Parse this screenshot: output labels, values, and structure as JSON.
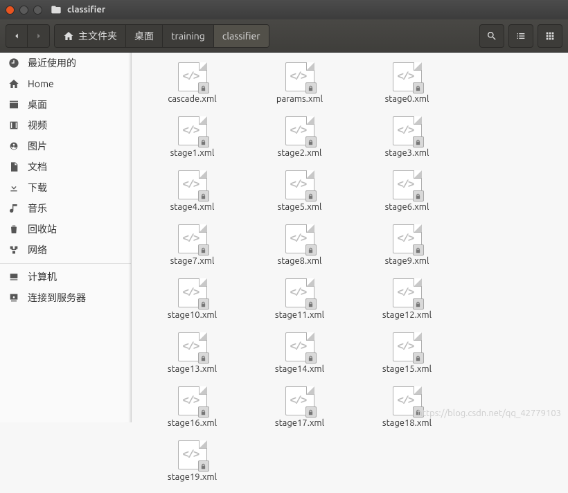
{
  "window": {
    "title": "classifier"
  },
  "path": [
    {
      "label": "主文件夹",
      "home": true
    },
    {
      "label": "桌面"
    },
    {
      "label": "training"
    },
    {
      "label": "classifier"
    }
  ],
  "sidebar": {
    "groups": [
      [
        {
          "icon": "clock",
          "label": "最近使用的"
        },
        {
          "icon": "home",
          "label": "Home"
        },
        {
          "icon": "desktop",
          "label": "桌面"
        },
        {
          "icon": "video",
          "label": "视频"
        },
        {
          "icon": "pictures",
          "label": "图片"
        },
        {
          "icon": "documents",
          "label": "文档"
        },
        {
          "icon": "downloads",
          "label": "下载"
        },
        {
          "icon": "music",
          "label": "音乐"
        },
        {
          "icon": "trash",
          "label": "回收站"
        },
        {
          "icon": "network",
          "label": "网络"
        }
      ],
      [
        {
          "icon": "computer",
          "label": "计算机"
        },
        {
          "icon": "server",
          "label": "连接到服务器"
        }
      ]
    ]
  },
  "files": [
    "cascade.xml",
    "params.xml",
    "stage0.xml",
    "stage1.xml",
    "stage2.xml",
    "stage3.xml",
    "stage4.xml",
    "stage5.xml",
    "stage6.xml",
    "stage7.xml",
    "stage8.xml",
    "stage9.xml",
    "stage10.xml",
    "stage11.xml",
    "stage12.xml",
    "stage13.xml",
    "stage14.xml",
    "stage15.xml",
    "stage16.xml",
    "stage17.xml",
    "stage18.xml",
    "stage19.xml"
  ],
  "watermark": "https://blog.csdn.net/qq_42779103"
}
